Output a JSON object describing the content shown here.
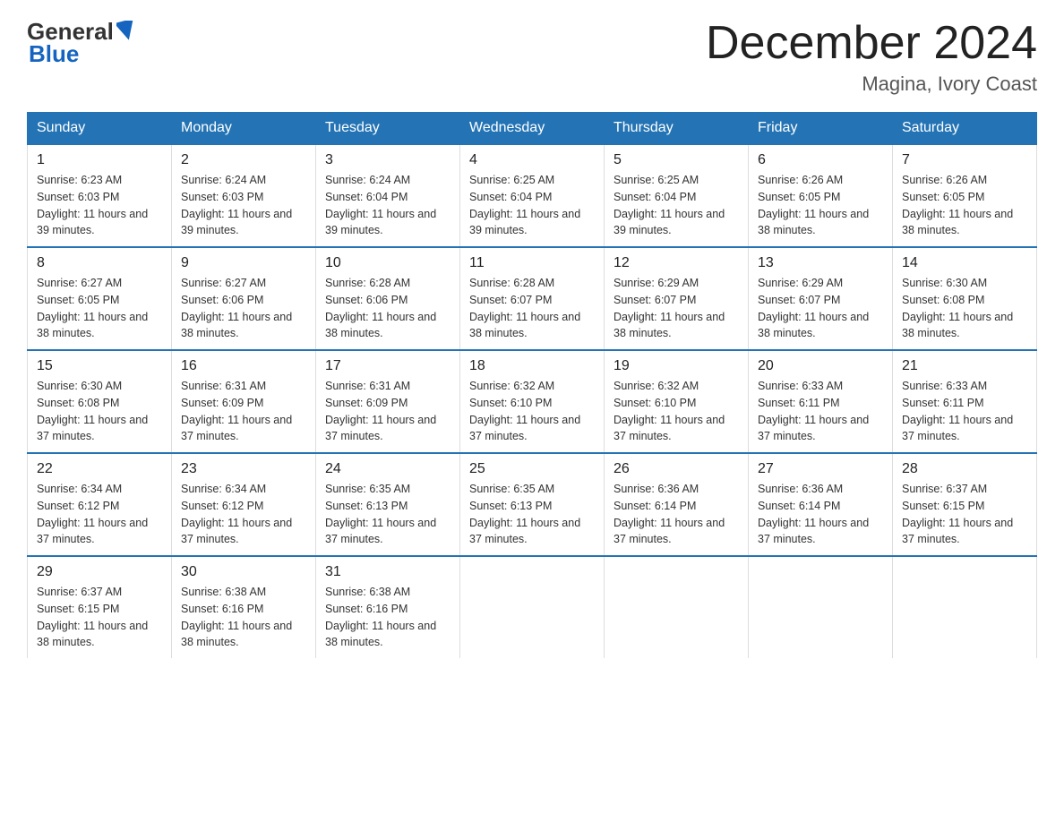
{
  "header": {
    "logo_general": "General",
    "logo_blue": "Blue",
    "month_title": "December 2024",
    "location": "Magina, Ivory Coast"
  },
  "days_of_week": [
    "Sunday",
    "Monday",
    "Tuesday",
    "Wednesday",
    "Thursday",
    "Friday",
    "Saturday"
  ],
  "weeks": [
    [
      {
        "day": "1",
        "sunrise": "6:23 AM",
        "sunset": "6:03 PM",
        "daylight": "11 hours and 39 minutes."
      },
      {
        "day": "2",
        "sunrise": "6:24 AM",
        "sunset": "6:03 PM",
        "daylight": "11 hours and 39 minutes."
      },
      {
        "day": "3",
        "sunrise": "6:24 AM",
        "sunset": "6:04 PM",
        "daylight": "11 hours and 39 minutes."
      },
      {
        "day": "4",
        "sunrise": "6:25 AM",
        "sunset": "6:04 PM",
        "daylight": "11 hours and 39 minutes."
      },
      {
        "day": "5",
        "sunrise": "6:25 AM",
        "sunset": "6:04 PM",
        "daylight": "11 hours and 39 minutes."
      },
      {
        "day": "6",
        "sunrise": "6:26 AM",
        "sunset": "6:05 PM",
        "daylight": "11 hours and 38 minutes."
      },
      {
        "day": "7",
        "sunrise": "6:26 AM",
        "sunset": "6:05 PM",
        "daylight": "11 hours and 38 minutes."
      }
    ],
    [
      {
        "day": "8",
        "sunrise": "6:27 AM",
        "sunset": "6:05 PM",
        "daylight": "11 hours and 38 minutes."
      },
      {
        "day": "9",
        "sunrise": "6:27 AM",
        "sunset": "6:06 PM",
        "daylight": "11 hours and 38 minutes."
      },
      {
        "day": "10",
        "sunrise": "6:28 AM",
        "sunset": "6:06 PM",
        "daylight": "11 hours and 38 minutes."
      },
      {
        "day": "11",
        "sunrise": "6:28 AM",
        "sunset": "6:07 PM",
        "daylight": "11 hours and 38 minutes."
      },
      {
        "day": "12",
        "sunrise": "6:29 AM",
        "sunset": "6:07 PM",
        "daylight": "11 hours and 38 minutes."
      },
      {
        "day": "13",
        "sunrise": "6:29 AM",
        "sunset": "6:07 PM",
        "daylight": "11 hours and 38 minutes."
      },
      {
        "day": "14",
        "sunrise": "6:30 AM",
        "sunset": "6:08 PM",
        "daylight": "11 hours and 38 minutes."
      }
    ],
    [
      {
        "day": "15",
        "sunrise": "6:30 AM",
        "sunset": "6:08 PM",
        "daylight": "11 hours and 37 minutes."
      },
      {
        "day": "16",
        "sunrise": "6:31 AM",
        "sunset": "6:09 PM",
        "daylight": "11 hours and 37 minutes."
      },
      {
        "day": "17",
        "sunrise": "6:31 AM",
        "sunset": "6:09 PM",
        "daylight": "11 hours and 37 minutes."
      },
      {
        "day": "18",
        "sunrise": "6:32 AM",
        "sunset": "6:10 PM",
        "daylight": "11 hours and 37 minutes."
      },
      {
        "day": "19",
        "sunrise": "6:32 AM",
        "sunset": "6:10 PM",
        "daylight": "11 hours and 37 minutes."
      },
      {
        "day": "20",
        "sunrise": "6:33 AM",
        "sunset": "6:11 PM",
        "daylight": "11 hours and 37 minutes."
      },
      {
        "day": "21",
        "sunrise": "6:33 AM",
        "sunset": "6:11 PM",
        "daylight": "11 hours and 37 minutes."
      }
    ],
    [
      {
        "day": "22",
        "sunrise": "6:34 AM",
        "sunset": "6:12 PM",
        "daylight": "11 hours and 37 minutes."
      },
      {
        "day": "23",
        "sunrise": "6:34 AM",
        "sunset": "6:12 PM",
        "daylight": "11 hours and 37 minutes."
      },
      {
        "day": "24",
        "sunrise": "6:35 AM",
        "sunset": "6:13 PM",
        "daylight": "11 hours and 37 minutes."
      },
      {
        "day": "25",
        "sunrise": "6:35 AM",
        "sunset": "6:13 PM",
        "daylight": "11 hours and 37 minutes."
      },
      {
        "day": "26",
        "sunrise": "6:36 AM",
        "sunset": "6:14 PM",
        "daylight": "11 hours and 37 minutes."
      },
      {
        "day": "27",
        "sunrise": "6:36 AM",
        "sunset": "6:14 PM",
        "daylight": "11 hours and 37 minutes."
      },
      {
        "day": "28",
        "sunrise": "6:37 AM",
        "sunset": "6:15 PM",
        "daylight": "11 hours and 37 minutes."
      }
    ],
    [
      {
        "day": "29",
        "sunrise": "6:37 AM",
        "sunset": "6:15 PM",
        "daylight": "11 hours and 38 minutes."
      },
      {
        "day": "30",
        "sunrise": "6:38 AM",
        "sunset": "6:16 PM",
        "daylight": "11 hours and 38 minutes."
      },
      {
        "day": "31",
        "sunrise": "6:38 AM",
        "sunset": "6:16 PM",
        "daylight": "11 hours and 38 minutes."
      },
      null,
      null,
      null,
      null
    ]
  ]
}
